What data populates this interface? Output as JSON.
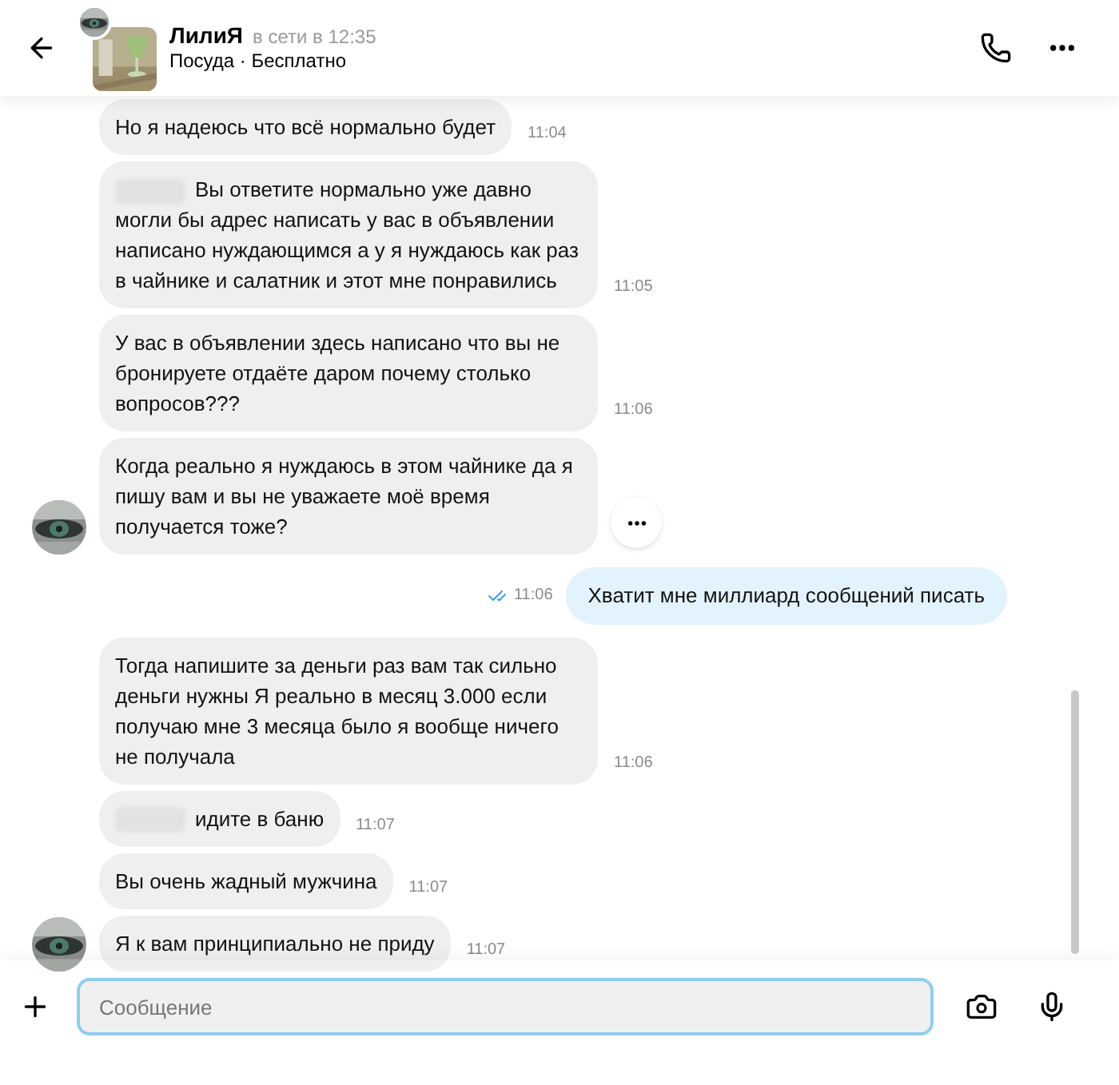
{
  "header": {
    "name": "ЛилиЯ",
    "presence": "в сети в 12:35",
    "subtitle": "Посуда · Бесплатно"
  },
  "messages": [
    {
      "kind": "incoming",
      "text": "Но я надеюсь что всё нормально будет",
      "time": "11:04"
    },
    {
      "kind": "incoming",
      "redacted": true,
      "text": "Вы ответите нормально уже давно могли бы адрес написать у вас в объявлении написано нуждающимся а у я нуждаюсь как раз в чайнике и салатник и этот мне понравились",
      "time": "11:05"
    },
    {
      "kind": "incoming",
      "text": "У вас в объявлении здесь написано что вы не бронируете отдаёте даром почему столько вопросов???",
      "time": "11:06"
    },
    {
      "kind": "incoming",
      "avatar": true,
      "menu": true,
      "text": "Когда реально я нуждаюсь в этом чайнике да я пишу вам и вы не уважаете моё время получается тоже?"
    },
    {
      "kind": "outgoing",
      "read": true,
      "text": "Хватит мне миллиард сообщений писать",
      "time": "11:06"
    },
    {
      "kind": "incoming",
      "text": "Тогда напишите за деньги раз вам так сильно деньги нужны Я реально в месяц 3.000 если получаю мне 3 месяца было я вообще ничего не получала",
      "time": "11:06"
    },
    {
      "kind": "incoming",
      "redacted": true,
      "text": "идите в баню",
      "time": "11:07"
    },
    {
      "kind": "incoming",
      "text": "Вы очень жадный мужчина",
      "time": "11:07"
    },
    {
      "kind": "incoming",
      "avatar": true,
      "text": "Я к вам принципиально не приду",
      "time": "11:07"
    }
  ],
  "composer": {
    "placeholder": "Сообщение"
  }
}
